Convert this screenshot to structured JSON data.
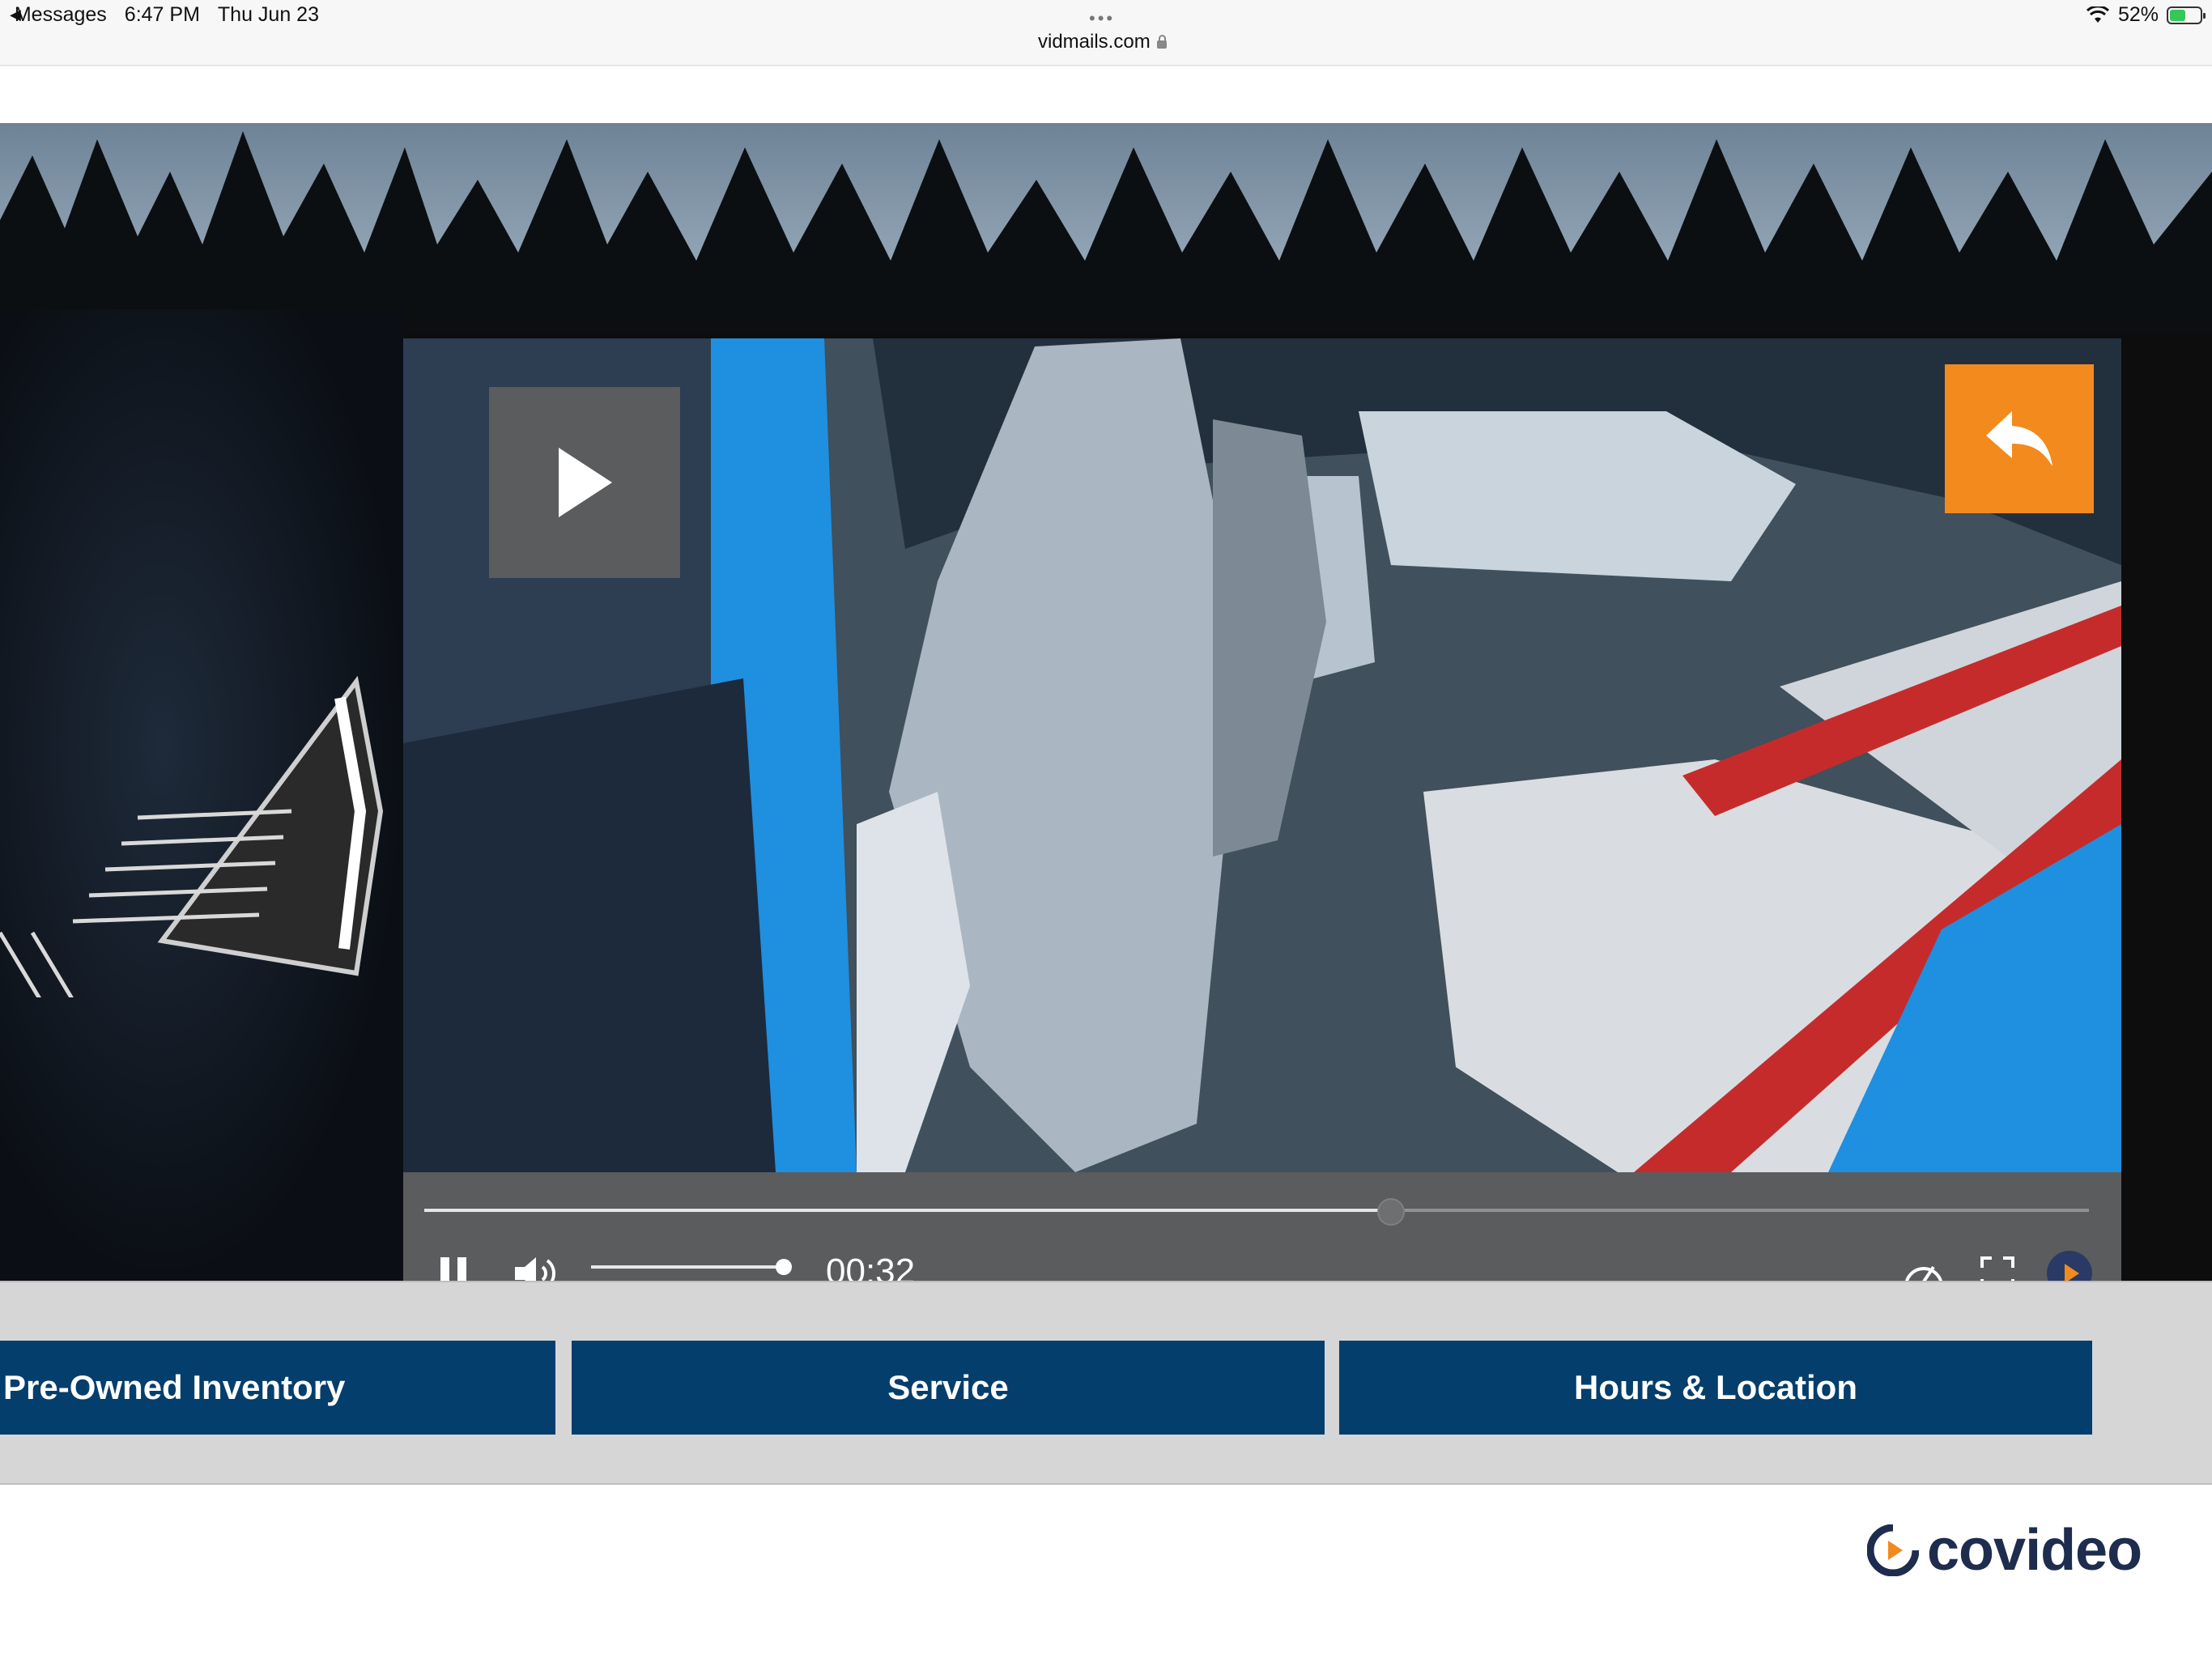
{
  "status_bar": {
    "back_app": "Messages",
    "time": "6:47 PM",
    "date": "Thu Jun 23",
    "url": "vidmails.com",
    "battery": "52%",
    "battery_level": 0.52
  },
  "player": {
    "time": "00:32",
    "progress": 0.58,
    "volume": 1.0,
    "back_button_color": "#f28a1e"
  },
  "nav": {
    "items": [
      {
        "label": "Pre-Owned Inventory"
      },
      {
        "label": "Service"
      },
      {
        "label": "Hours & Location"
      }
    ],
    "color": "#033e6c"
  },
  "footer": {
    "brand": "covideo"
  }
}
